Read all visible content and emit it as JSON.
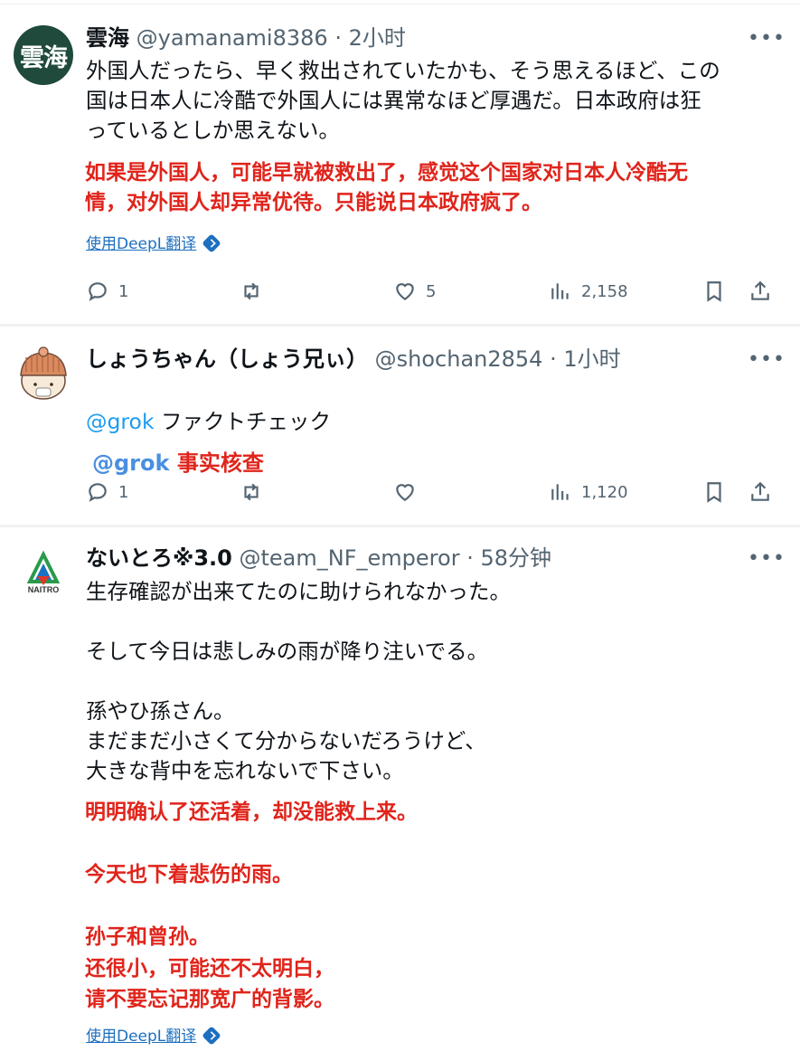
{
  "tweets": [
    {
      "avatar_text": "雲海",
      "name": "雲海",
      "handle": "@yamanami8386",
      "time": "2小时",
      "text": "外国人だったら、早く救出されていたかも、そう思えるほど、この\n国は日本人に冷酷で外国人には異常なほど厚遇だ。日本政府は狂\nっているとしか思えない。",
      "translation": "如果是外国人，可能早就被救出了，感觉这个国家对日本人冷酷无\n情，对外国人却异常优待。只能说日本政府疯了。",
      "deepl_label": "使用DeepL翻译",
      "replies": "1",
      "retweets": "",
      "likes": "5",
      "views": "2,158"
    },
    {
      "name": "しょうちゃん（しょう兄ぃ）",
      "handle": "@shochan2854",
      "time": "1小时",
      "mention": "@grok",
      "text_rest": "ファクトチェック",
      "translation_mention": "@grok",
      "translation_rest": "事实核查",
      "replies": "1",
      "retweets": "",
      "likes": "",
      "views": "1,120"
    },
    {
      "avatar_text": "NAITRO",
      "name": "ないとろ※3.0",
      "handle": "@team_NF_emperor",
      "time": "58分钟",
      "text": "生存確認が出来てたのに助けられなかった。\n\nそして今日は悲しみの雨が降り注いでる。\n\n孫やひ孫さん。\nまだまだ小さくて分からないだろうけど、\n大きな背中を忘れないで下さい。",
      "translation": "明明确认了还活着，却没能救上来。\n\n今天也下着悲伤的雨。\n\n孙子和曾孙。\n还很小，可能还不太明白，\n请不要忘记那宽广的背影。",
      "deepl_label": "使用DeepL翻译"
    }
  ],
  "sep": " · ",
  "more_label": "•••",
  "icons": [
    "reply-icon",
    "retweet-icon",
    "like-icon",
    "views-icon",
    "bookmark-icon",
    "share-icon",
    "more-icon",
    "deepl-icon"
  ],
  "colors": {
    "translation_red": "#e0241b",
    "link_blue": "#1d9bf0",
    "deepl_blue": "#1d6fbf",
    "muted": "#536471"
  }
}
